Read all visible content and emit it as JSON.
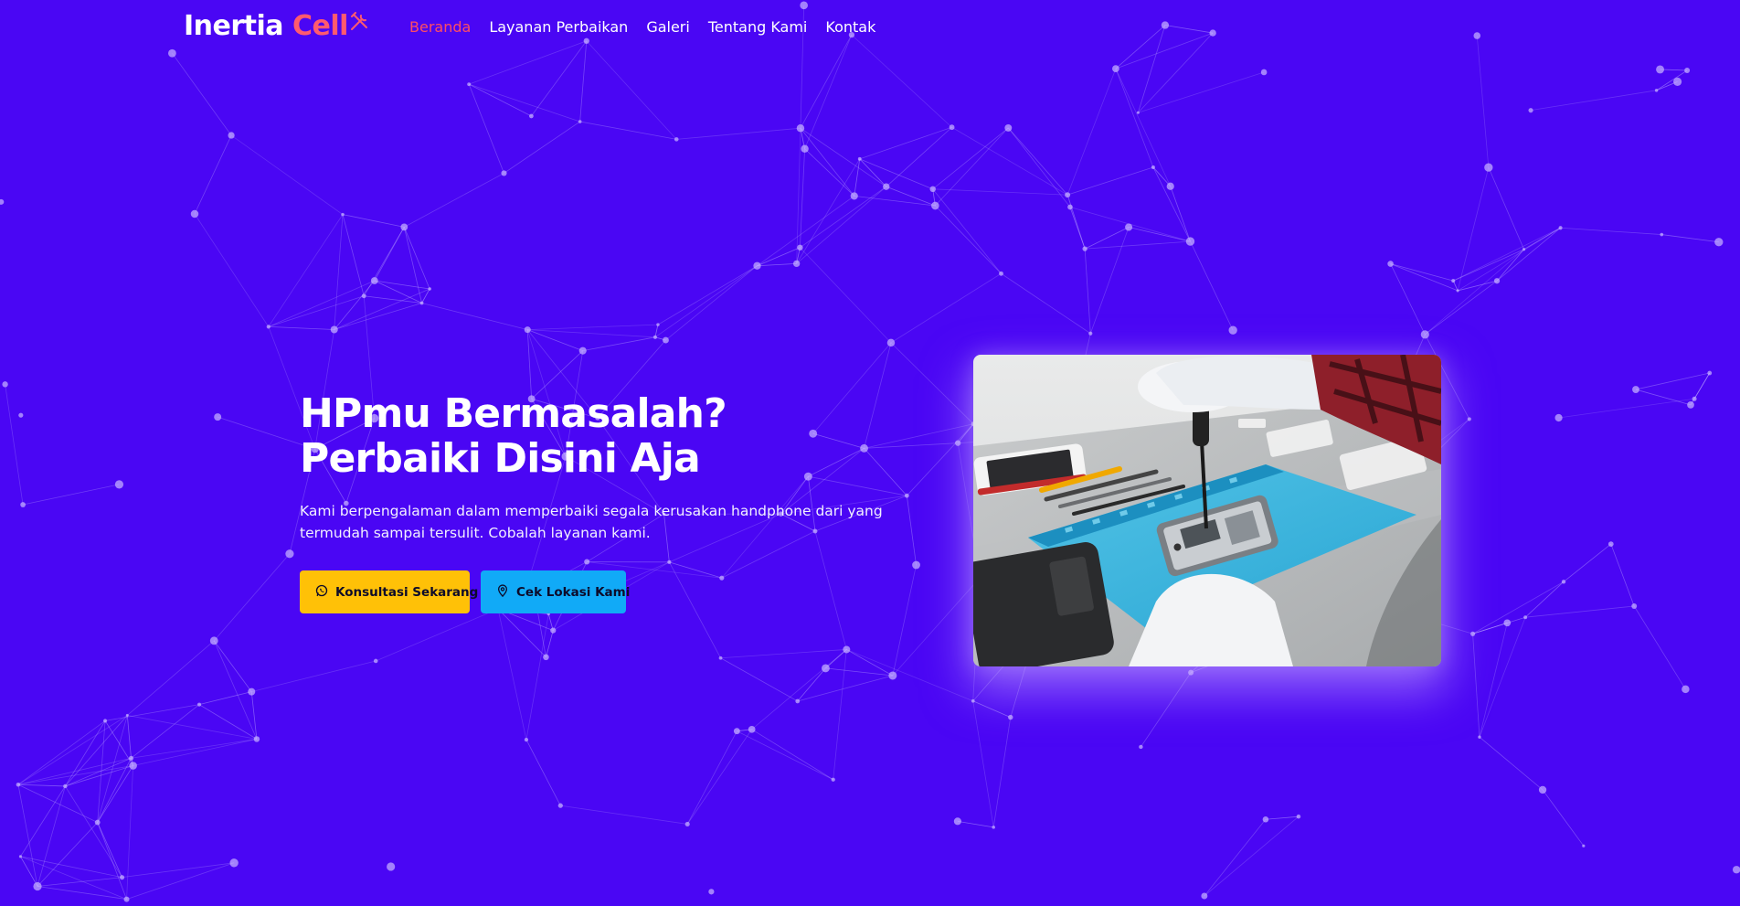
{
  "brand": {
    "name": "Inertia",
    "accent": "Cell",
    "icon": "tools-icon",
    "accent_color": "#ff5a6e"
  },
  "nav": {
    "items": [
      {
        "label": "Beranda",
        "active": true
      },
      {
        "label": "Layanan Perbaikan",
        "active": false
      },
      {
        "label": "Galeri",
        "active": false
      },
      {
        "label": "Tentang Kami",
        "active": false
      },
      {
        "label": "Kontak",
        "active": false
      }
    ],
    "active_color": "#ff4d63"
  },
  "hero": {
    "title_line1": "HPmu Bermasalah?",
    "title_line2": "Perbaiki Disini Aja",
    "description": "Kami berpengalaman dalam memperbaiki segala kerusakan handphone dari yang termudah sampai tersulit. Cobalah layanan kami.",
    "buttons": {
      "consult": {
        "label": "Konsultasi Sekarang",
        "icon": "whatsapp-icon",
        "color": "#ffc107"
      },
      "location": {
        "label": "Cek Lokasi Kami",
        "icon": "map-pin-icon",
        "color": "#11aaf7"
      }
    },
    "image": {
      "alt": "technician repairing smartphone"
    }
  },
  "theme": {
    "background": "#4a06f4",
    "text": "#ffffff"
  }
}
